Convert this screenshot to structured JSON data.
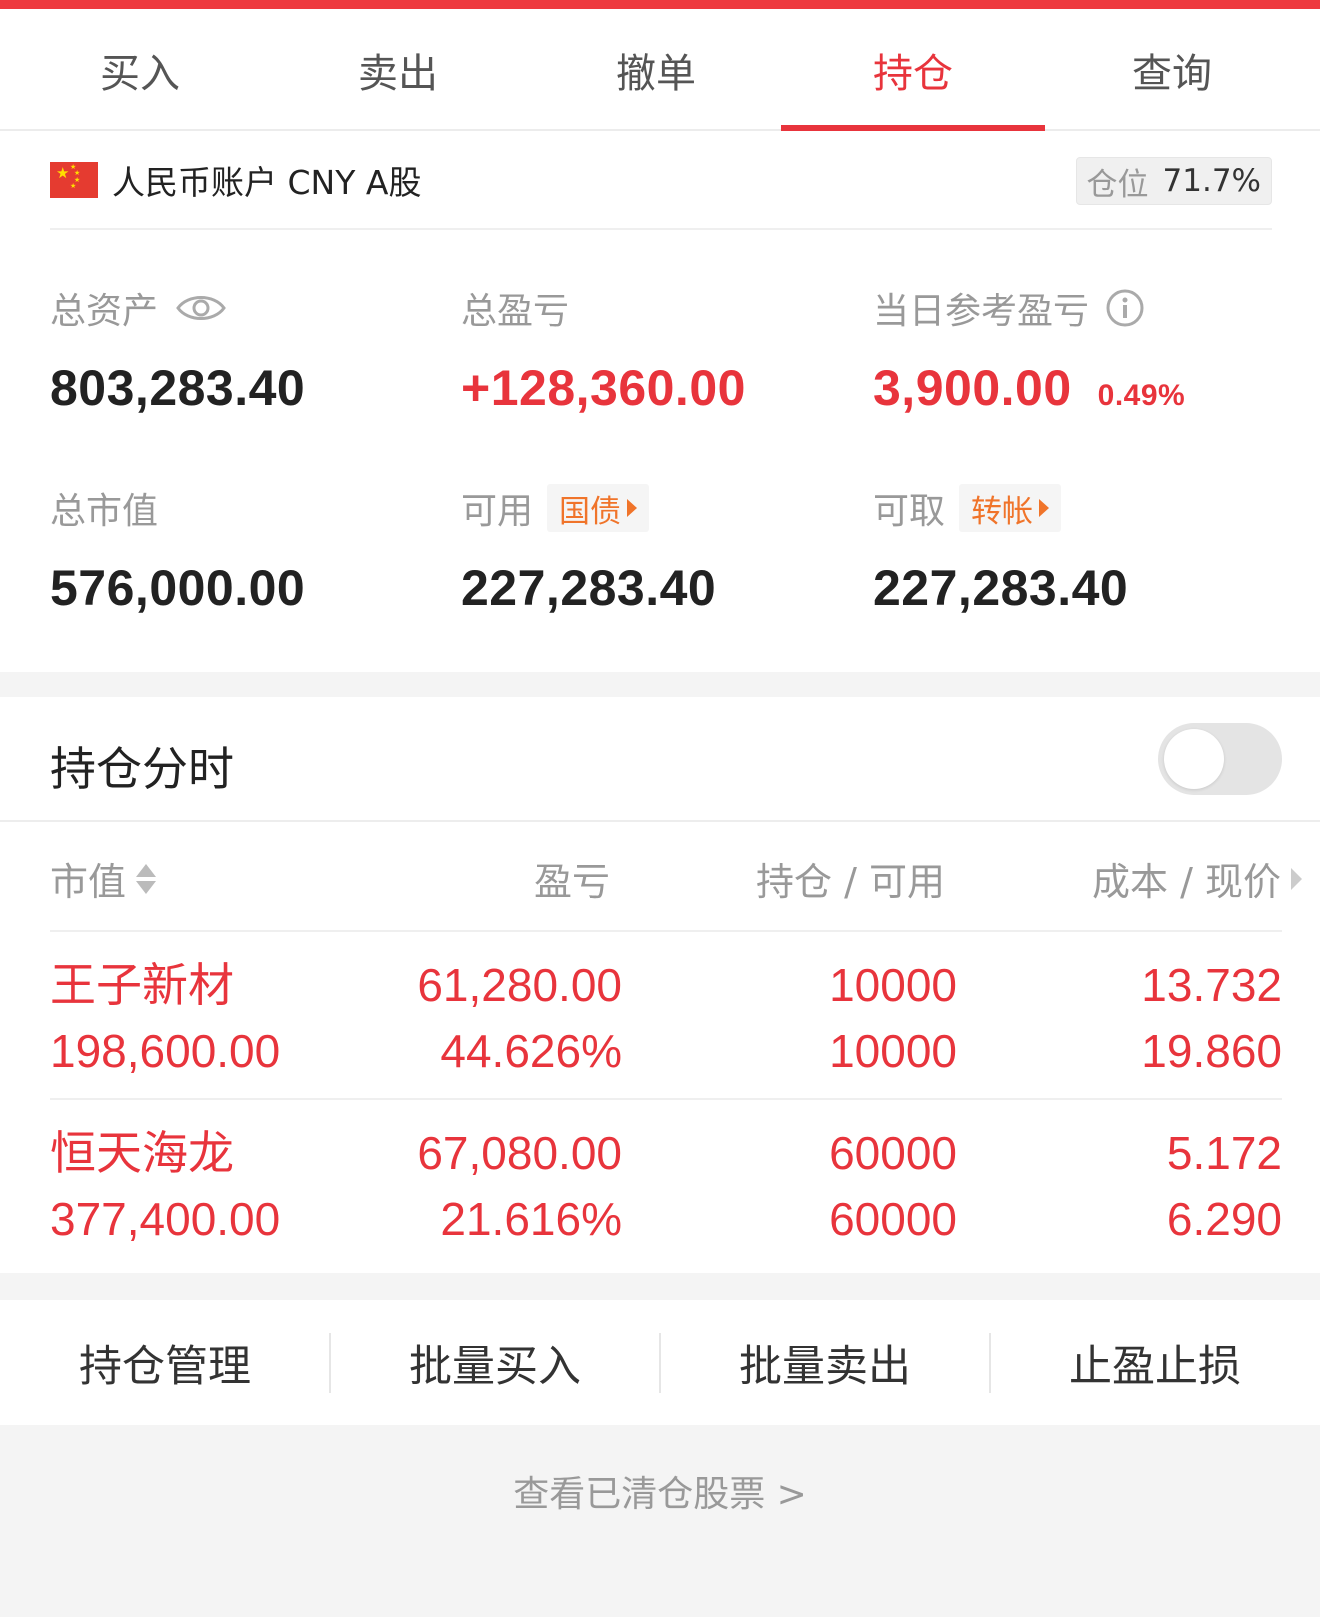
{
  "theme": {
    "accent": "#e8343c",
    "orange": "#f0742a"
  },
  "tabs": [
    {
      "label": "买入"
    },
    {
      "label": "卖出"
    },
    {
      "label": "撤单"
    },
    {
      "label": "持仓",
      "active": true
    },
    {
      "label": "查询"
    }
  ],
  "account": {
    "name": "人民币账户 CNY A股",
    "flag_icon": "china-flag-icon",
    "position_ratio_label": "仓位",
    "position_ratio_value": "71.7%",
    "total_assets": {
      "label": "总资产",
      "value": "803,283.40",
      "icon": "eye-icon"
    },
    "total_pnl": {
      "label": "总盈亏",
      "value": "+128,360.00"
    },
    "daily_pnl": {
      "label": "当日参考盈亏",
      "value": "3,900.00",
      "percent": "0.49%",
      "icon": "info-icon"
    },
    "market_value": {
      "label": "总市值",
      "value": "576,000.00"
    },
    "available": {
      "label": "可用",
      "tag": "国债",
      "value": "227,283.40"
    },
    "withdrawable": {
      "label": "可取",
      "tag": "转帐",
      "value": "227,283.40"
    }
  },
  "holdings": {
    "title": "持仓分时",
    "toggle_on": false,
    "columns": {
      "market_value": "市值",
      "pnl": "盈亏",
      "position": "持仓 / 可用",
      "price": "成本 / 现价"
    },
    "rows": [
      {
        "name": "王子新材",
        "market_value": "198,600.00",
        "pnl": "61,280.00",
        "pnl_pct": "44.626%",
        "position": "10000",
        "available": "10000",
        "cost": "13.732",
        "price": "19.860"
      },
      {
        "name": "恒天海龙",
        "market_value": "377,400.00",
        "pnl": "67,080.00",
        "pnl_pct": "21.616%",
        "position": "60000",
        "available": "60000",
        "cost": "5.172",
        "price": "6.290"
      }
    ]
  },
  "actions": [
    {
      "label": "持仓管理"
    },
    {
      "label": "批量买入"
    },
    {
      "label": "批量卖出"
    },
    {
      "label": "止盈止损"
    }
  ],
  "cleared_link": "查看已清仓股票 >"
}
